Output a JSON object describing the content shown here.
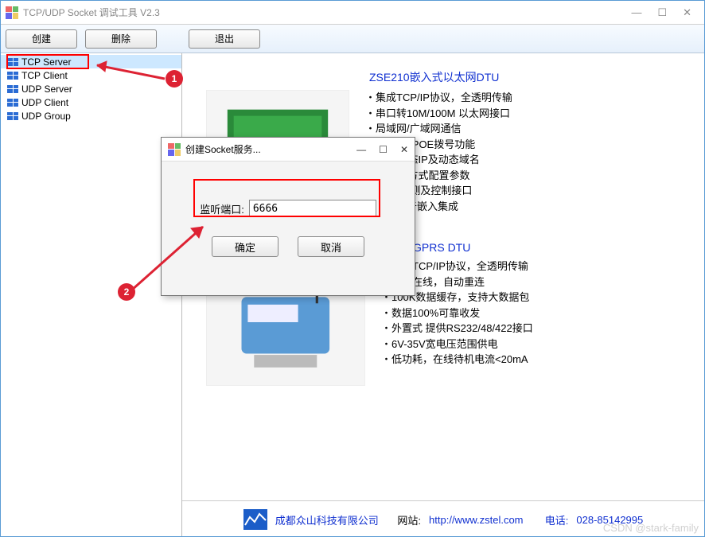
{
  "window": {
    "title": "TCP/UDP Socket 调试工具 V2.3",
    "controls": {
      "min": "—",
      "max": "☐",
      "close": "✕"
    }
  },
  "toolbar": {
    "create": "创建",
    "delete": "删除",
    "exit": "退出"
  },
  "sidebar": {
    "items": [
      "TCP Server",
      "TCP Client",
      "UDP Server",
      "UDP Client",
      "UDP Group"
    ],
    "selected_index": 0
  },
  "dialog": {
    "title": "创建Socket服务...",
    "controls": {
      "min": "—",
      "max": "☐",
      "close": "✕"
    },
    "port_label": "监听端口:",
    "port_value": "6666",
    "ok": "确定",
    "cancel": "取消"
  },
  "products": [
    {
      "title": "ZSE210嵌入式以太网DTU",
      "bullets": [
        "集成TCP/IP协议，全透明传输",
        "串口转10M/100M 以太网接口",
        "局域网/广域网通信",
        "DSL PPPOE拨号功能",
        "HCP动态IP及动态域名",
        "eb网页方式配置参数",
        "路I/O检测及控制接口",
        "小，易于嵌入集成"
      ]
    },
    {
      "title_suffix": "GPRS DTU",
      "bullets": [
        "集成TCP/IP协议，全透明传输",
        "永远在线，自动重连",
        "100K数据缓存，支持大数据包",
        "数据100%可靠收发",
        "外置式 提供RS232/48/422接口",
        "6V-35V宽电压范围供电",
        "低功耗，在线待机电流<20mA"
      ]
    }
  ],
  "footer": {
    "company": "成都众山科技有限公司",
    "site_label": "网站:",
    "site_url": "http://www.zstel.com",
    "phone_label": "电话:",
    "phone": "028-85142995"
  },
  "watermark": "CSDN @stark-family",
  "annotations": {
    "badge1": "1",
    "badge2": "2"
  }
}
